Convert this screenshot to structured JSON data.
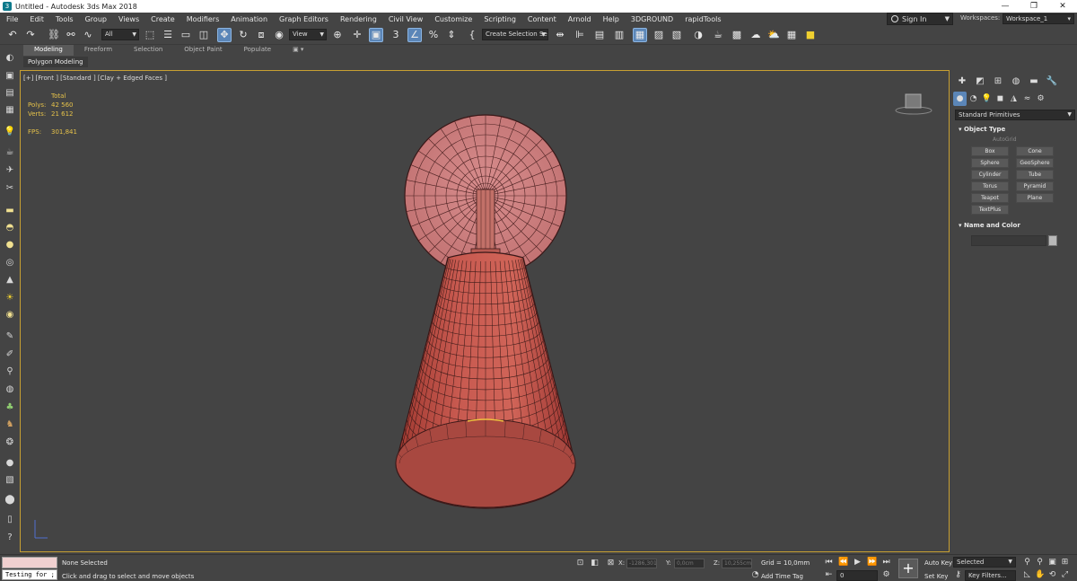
{
  "window": {
    "title": "Untitled - Autodesk 3ds Max 2018",
    "controls": [
      "—",
      "❐",
      "✕"
    ]
  },
  "menu": {
    "items": [
      "File",
      "Edit",
      "Tools",
      "Group",
      "Views",
      "Create",
      "Modifiers",
      "Animation",
      "Graph Editors",
      "Rendering",
      "Civil View",
      "Customize",
      "Scripting",
      "Content",
      "Arnold",
      "Help",
      "3DGROUND",
      "rapidTools"
    ],
    "sign_in": "Sign In",
    "workspaces_label": "Workspaces:",
    "workspace_value": "Workspace_1"
  },
  "toolbar": {
    "filter_value": "All",
    "coord_system": "View",
    "selection_set": "Create Selection Se",
    "snap_label": "3",
    "active_color": "#5b86b8"
  },
  "ribbon": {
    "tabs": [
      "Modeling",
      "Freeform",
      "Selection",
      "Object Paint",
      "Populate"
    ],
    "sub_label": "Polygon Modeling"
  },
  "viewport": {
    "label": "[+] [Front ] [Standard ] [Clay + Edged Faces ]",
    "stats_header": "Total",
    "polys_label": "Polys:",
    "polys_value": "42 560",
    "verts_label": "Verts:",
    "verts_value": "21 612",
    "fps_label": "FPS:",
    "fps_value": "301,841",
    "border_color": "#c8a032",
    "model_color": "#c8504c"
  },
  "command_panel": {
    "dropdown": "Standard Primitives",
    "object_type_title": "Object Type",
    "autogrid": "AutoGrid",
    "primitives": [
      "Box",
      "Cone",
      "Sphere",
      "GeoSphere",
      "Cylinder",
      "Tube",
      "Torus",
      "Pyramid",
      "Teapot",
      "Plane",
      "TextPlus"
    ],
    "name_color_title": "Name and Color"
  },
  "status": {
    "maxscript_text": "Testing for ;",
    "selection": "None Selected",
    "prompt": "Click and drag to select and move objects",
    "x_label": "X:",
    "x_value": "-1286,301",
    "y_label": "Y:",
    "y_value": "0,0cm",
    "z_label": "Z:",
    "z_value": "10,255cm",
    "grid": "Grid = 10,0mm",
    "add_time_tag": "Add Time Tag",
    "frame_value": "0",
    "auto_key": "Auto Key",
    "set_key": "Set Key",
    "selected_value": "Selected",
    "key_filters": "Key Filters..."
  }
}
